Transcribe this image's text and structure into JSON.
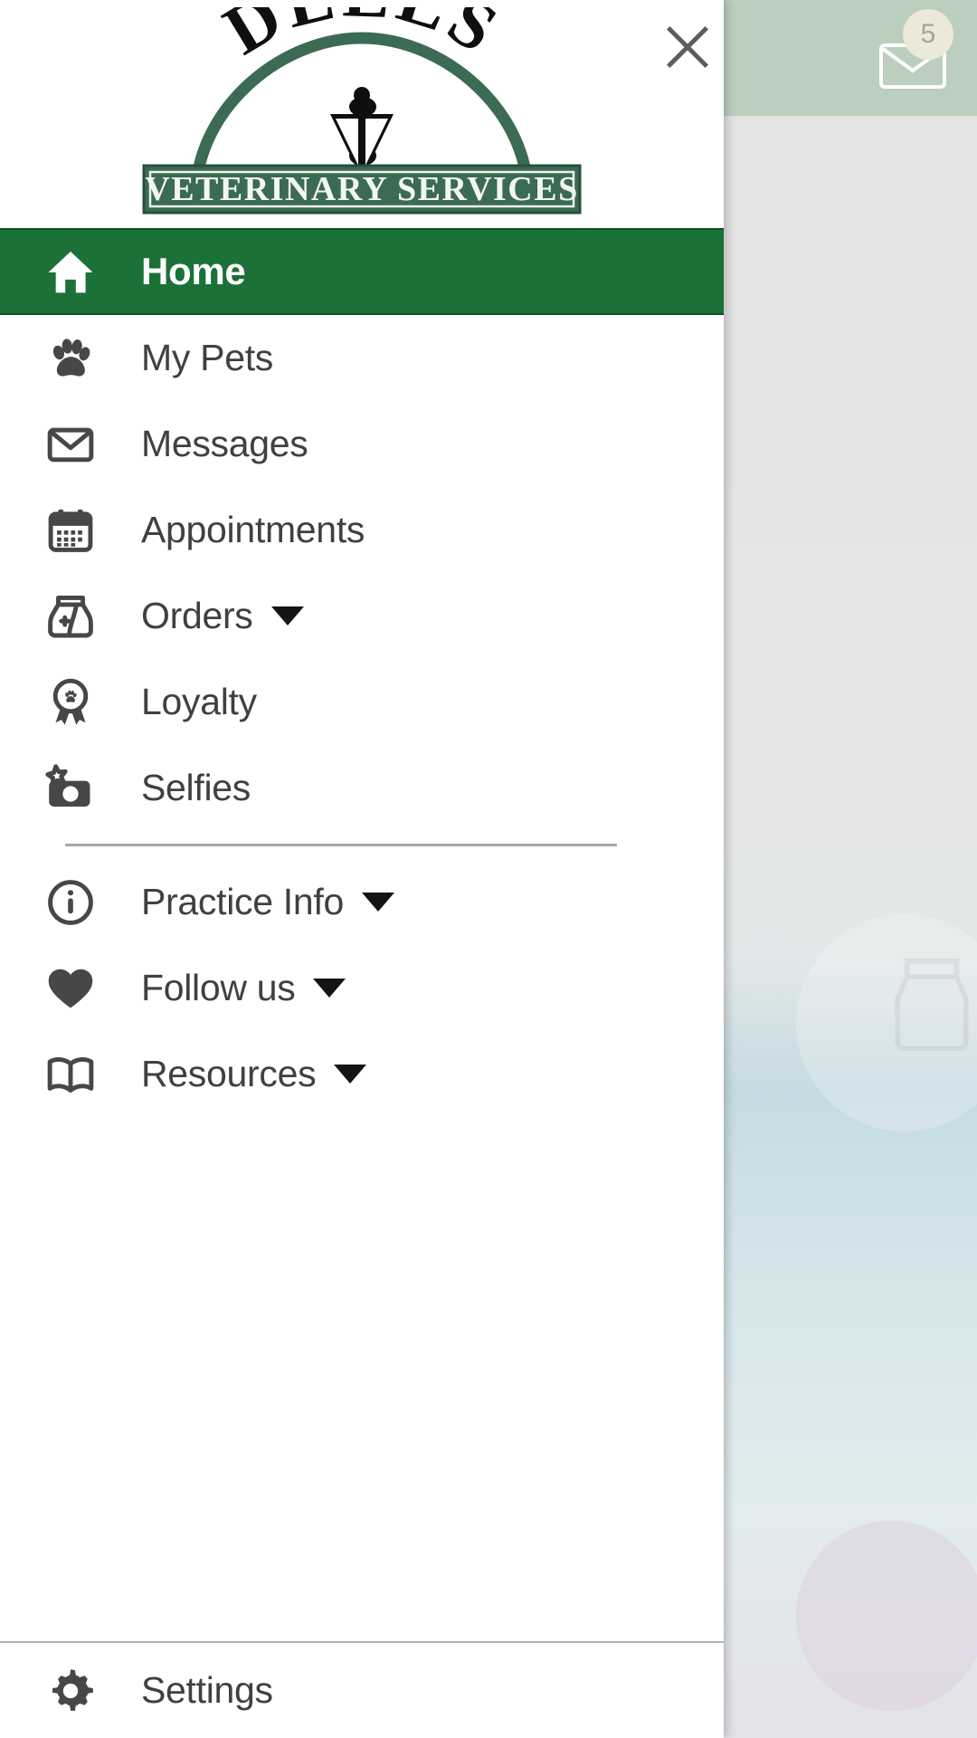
{
  "window": {
    "app_kind": "veterinary-practice-mobile-app",
    "drawer_open": true
  },
  "backdrop": {
    "message_badge_count": "5",
    "mail_icon": "mail-icon",
    "bag_icon": "food-bag-icon"
  },
  "close_button": {
    "icon": "close-icon",
    "label": "Close"
  },
  "logo": {
    "top_text": "DELLS",
    "banner_text": "VETERINARY SERVICES",
    "emblem": "veterinary-caduceus-emblem",
    "arc_color": "#3c6b53",
    "banner_color": "#3c6b53"
  },
  "colors": {
    "accent_green": "#1b7138",
    "active_border": "#0d4f23",
    "icon_gray": "#474747",
    "text_gray": "#404040",
    "divider_gray": "#a8a8a8"
  },
  "menu": {
    "primary": [
      {
        "label": "Home",
        "icon": "home-icon",
        "active": true,
        "expandable": false
      },
      {
        "label": "My Pets",
        "icon": "paw-icon",
        "active": false,
        "expandable": false
      },
      {
        "label": "Messages",
        "icon": "envelope-icon",
        "active": false,
        "expandable": false
      },
      {
        "label": "Appointments",
        "icon": "calendar-icon",
        "active": false,
        "expandable": false
      },
      {
        "label": "Orders",
        "icon": "food-bag-icon",
        "active": false,
        "expandable": true
      },
      {
        "label": "Loyalty",
        "icon": "award-paw-icon",
        "active": false,
        "expandable": false
      },
      {
        "label": "Selfies",
        "icon": "camera-star-icon",
        "active": false,
        "expandable": false
      }
    ],
    "secondary": [
      {
        "label": "Practice Info",
        "icon": "info-circle-icon",
        "expandable": true
      },
      {
        "label": "Follow us",
        "icon": "heart-icon",
        "expandable": true
      },
      {
        "label": "Resources",
        "icon": "open-book-icon",
        "expandable": true
      }
    ],
    "bottom": [
      {
        "label": "Settings",
        "icon": "gear-icon",
        "expandable": false
      }
    ]
  }
}
